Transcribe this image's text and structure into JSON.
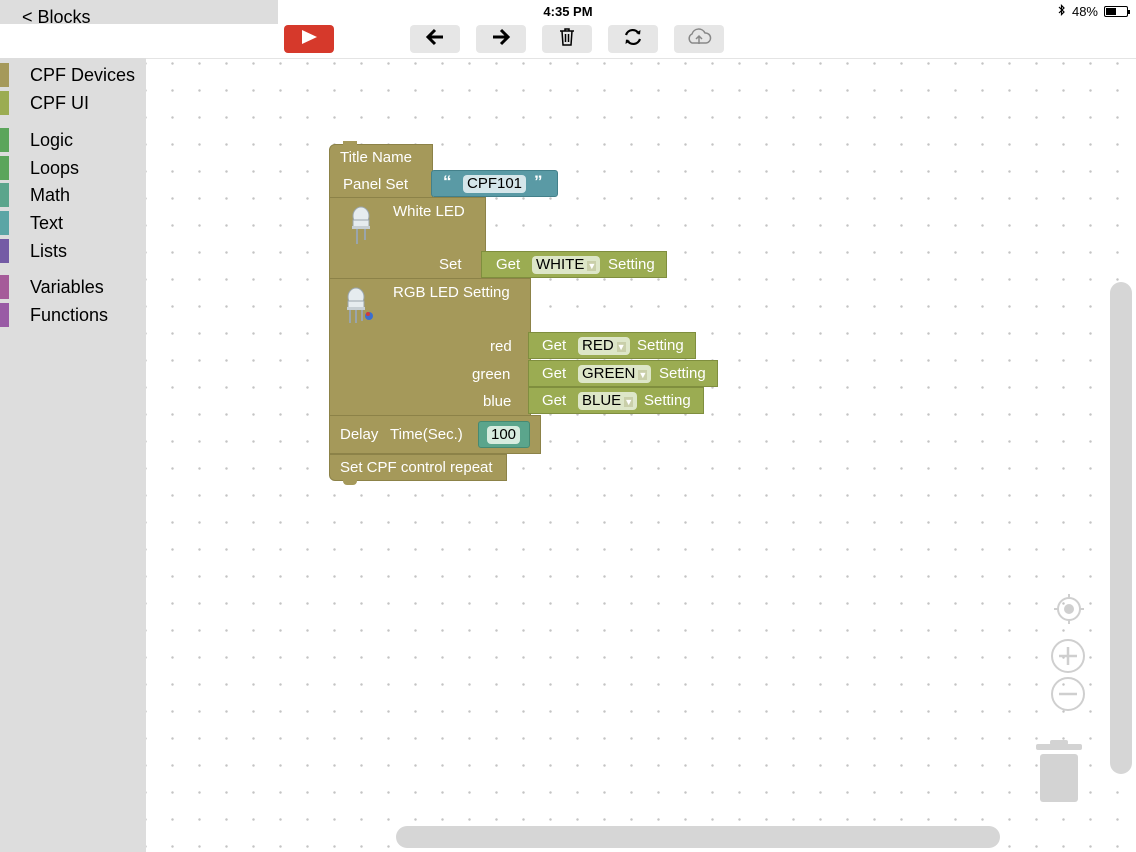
{
  "status_bar": {
    "device": "iPad",
    "time": "4:35 PM",
    "battery": "48%",
    "battery_level": 0.48
  },
  "sidebar": {
    "back_label": "< Blocks",
    "categories": [
      {
        "label": "CPF Devices",
        "color": "#a5995a"
      },
      {
        "label": "CPF UI",
        "color": "#9bac52"
      },
      {
        "label": "Logic",
        "color": "#5ba55b"
      },
      {
        "label": "Loops",
        "color": "#5ba55b"
      },
      {
        "label": "Math",
        "color": "#5ba58c"
      },
      {
        "label": "Text",
        "color": "#5ba5a5"
      },
      {
        "label": "Lists",
        "color": "#745ba5"
      },
      {
        "label": "Variables",
        "color": "#a55b99"
      },
      {
        "label": "Functions",
        "color": "#995ba5"
      }
    ]
  },
  "toolbar": {
    "icons": [
      "play-icon",
      "arrow-left-icon",
      "arrow-right-icon",
      "trash-icon",
      "refresh-icon",
      "cloud-upload-icon"
    ],
    "run_color": "#d6392b"
  },
  "blocks": {
    "title_name": "Title Name",
    "panel_set": "Panel Set",
    "panel_value": "CPF101",
    "open_quote": "“",
    "close_quote": "”",
    "white_led": "White LED",
    "set_label": "Set",
    "get_label": "Get",
    "white_value": "WHITE",
    "setting_label": "Setting",
    "rgb_led": "RGB LED Setting",
    "red_label": "red",
    "green_label": "green",
    "blue_label": "blue",
    "red_value": "RED",
    "green_value": "GREEN",
    "blue_value": "BLUE",
    "delay_label": "Delay",
    "time_label": "Time(Sec.)",
    "delay_value": "100",
    "repeat_label": "Set CPF control repeat",
    "colors": {
      "olive": "#a5995a",
      "green": "#9bac52",
      "teal": "#5a9aa5"
    }
  }
}
